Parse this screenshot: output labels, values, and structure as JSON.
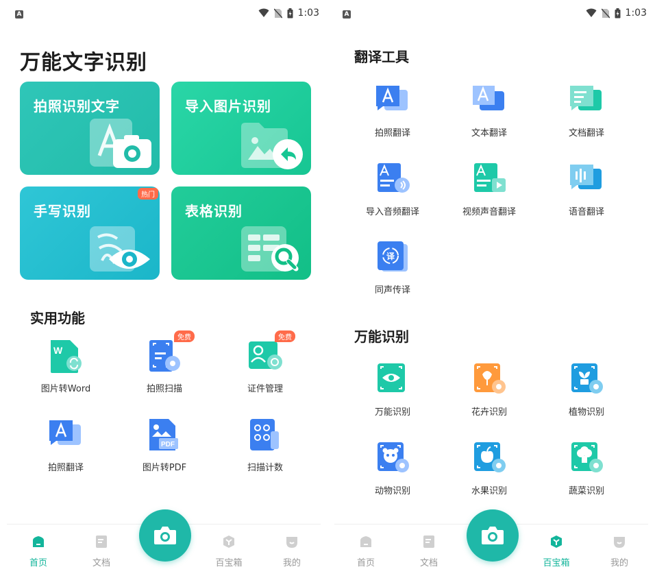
{
  "status": {
    "time": "1:03",
    "notification_icon": "a-icon"
  },
  "home": {
    "title": "万能文字识别",
    "cards": [
      {
        "label": "拍照识别文字",
        "icon": "camera-icon"
      },
      {
        "label": "导入图片识别",
        "icon": "import-icon"
      },
      {
        "label": "手写识别",
        "badge": "热门",
        "icon": "eye-icon"
      },
      {
        "label": "表格识别",
        "icon": "magnifier-icon"
      }
    ],
    "practical": {
      "title": "实用功能",
      "items": [
        {
          "label": "图片转Word",
          "icon": "word-convert-icon"
        },
        {
          "label": "拍照扫描",
          "badge": "免费",
          "icon": "scan-icon"
        },
        {
          "label": "证件管理",
          "badge": "免费",
          "icon": "id-card-icon"
        },
        {
          "label": "拍照翻译",
          "icon": "photo-translate-icon"
        },
        {
          "label": "图片转PDF",
          "icon": "pdf-icon"
        },
        {
          "label": "扫描计数",
          "icon": "count-icon"
        }
      ]
    }
  },
  "toolbox": {
    "translate": {
      "title": "翻译工具",
      "items": [
        {
          "label": "拍照翻译",
          "icon": "photo-translate-icon"
        },
        {
          "label": "文本翻译",
          "icon": "text-translate-icon"
        },
        {
          "label": "文档翻译",
          "icon": "doc-translate-icon"
        },
        {
          "label": "导入音频翻译",
          "icon": "audio-translate-icon"
        },
        {
          "label": "视频声音翻译",
          "icon": "video-translate-icon"
        },
        {
          "label": "语音翻译",
          "icon": "voice-translate-icon"
        },
        {
          "label": "同声传译",
          "icon": "interpret-icon"
        }
      ]
    },
    "recognize": {
      "title": "万能识别",
      "items": [
        {
          "label": "万能识别",
          "icon": "eye-scan-icon"
        },
        {
          "label": "花卉识别",
          "icon": "flower-icon"
        },
        {
          "label": "植物识别",
          "icon": "plant-icon"
        },
        {
          "label": "动物识别",
          "icon": "animal-icon"
        },
        {
          "label": "水果识别",
          "icon": "fruit-icon"
        },
        {
          "label": "蔬菜识别",
          "icon": "vegetable-icon"
        }
      ]
    }
  },
  "nav": {
    "items": [
      {
        "label": "首页"
      },
      {
        "label": "文档"
      },
      {
        "label": "百宝箱"
      },
      {
        "label": "我的"
      }
    ]
  },
  "colors": {
    "brand": "#1fb8a8",
    "active": "#13b59b",
    "badge": "#ff6b4a"
  }
}
